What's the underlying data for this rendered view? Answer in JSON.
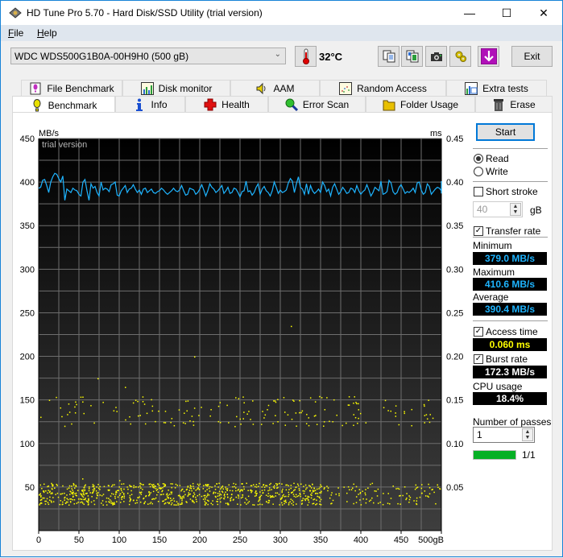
{
  "window": {
    "title": "HD Tune Pro 5.70 - Hard Disk/SSD Utility (trial version)",
    "controls": {
      "minimize": "—",
      "maximize": "☐",
      "close": "✕"
    }
  },
  "menu": [
    {
      "label": "File",
      "accel": "F",
      "rest": "ile"
    },
    {
      "label": "Help",
      "accel": "H",
      "rest": "elp"
    }
  ],
  "toolbar": {
    "drive": "WDC WDS500G1B0A-00H9H0 (500 gB)",
    "temperature": "32°C",
    "buttons": [
      "copy-text",
      "copy-screenshot",
      "camera",
      "options",
      "save"
    ],
    "exit_label": "Exit"
  },
  "tabs": {
    "top_row": [
      {
        "label": "File Benchmark",
        "icon": "file-benchmark-icon"
      },
      {
        "label": "Disk monitor",
        "icon": "disk-monitor-icon"
      },
      {
        "label": "AAM",
        "icon": "speaker-icon"
      },
      {
        "label": "Random Access",
        "icon": "random-access-icon"
      },
      {
        "label": "Extra tests",
        "icon": "extra-tests-icon"
      }
    ],
    "bottom_row": [
      {
        "label": "Benchmark",
        "icon": "benchmark-icon",
        "active": true
      },
      {
        "label": "Info",
        "icon": "info-icon"
      },
      {
        "label": "Health",
        "icon": "health-icon"
      },
      {
        "label": "Error Scan",
        "icon": "error-scan-icon"
      },
      {
        "label": "Folder Usage",
        "icon": "folder-icon"
      },
      {
        "label": "Erase",
        "icon": "trash-icon"
      }
    ]
  },
  "controls": {
    "start_label": "Start",
    "read_label": "Read",
    "write_label": "Write",
    "mode_selected": "Read",
    "short_stroke_label": "Short stroke",
    "short_stroke_checked": false,
    "short_stroke_value": "40",
    "short_stroke_unit": "gB",
    "transfer_rate_label": "Transfer rate",
    "transfer_rate_checked": true,
    "minimum_label": "Minimum",
    "minimum_value": "379.0 MB/s",
    "maximum_label": "Maximum",
    "maximum_value": "410.6 MB/s",
    "average_label": "Average",
    "average_value": "390.4 MB/s",
    "access_time_label": "Access time",
    "access_time_checked": true,
    "access_time_value": "0.060 ms",
    "burst_rate_label": "Burst rate",
    "burst_rate_checked": true,
    "burst_rate_value": "172.3 MB/s",
    "cpu_usage_label": "CPU usage",
    "cpu_usage_value": "18.4%",
    "passes_label": "Number of passes",
    "passes_value": "1",
    "progress_fraction": 1.0,
    "progress_text": "1/1"
  },
  "colors": {
    "transfer_line": "#1eb4ff",
    "access_points": "#ffff00",
    "value_cyan": "#1eb4ff",
    "value_yellow": "#ffff00",
    "value_white": "#ffffff",
    "progress": "#06b025"
  },
  "chart_data": {
    "type": "line",
    "title": "",
    "watermark": "trial version",
    "xlabel": "gB",
    "ylabel_left": "MB/s",
    "ylabel_right": "ms",
    "xlim": [
      0,
      500
    ],
    "ylim_left": [
      0,
      450
    ],
    "ylim_right": [
      0,
      0.45
    ],
    "x_ticks": [
      "0",
      "50",
      "100",
      "150",
      "200",
      "250",
      "300",
      "350",
      "400",
      "450",
      "500gB"
    ],
    "y_ticks_left": [
      "50",
      "100",
      "150",
      "200",
      "250",
      "300",
      "350",
      "400",
      "450"
    ],
    "y_ticks_right": [
      "0.05",
      "0.10",
      "0.15",
      "0.20",
      "0.25",
      "0.30",
      "0.35",
      "0.40",
      "0.45"
    ],
    "grid": true,
    "series": [
      {
        "name": "Transfer rate (MB/s)",
        "axis": "left",
        "x_step": 2.5,
        "values": [
          393,
          394,
          402,
          403,
          396,
          388,
          400,
          406,
          410,
          409,
          404,
          400,
          407,
          379,
          392,
          390,
          388,
          393,
          391,
          390,
          386,
          384,
          400,
          403,
          390,
          379,
          398,
          393,
          395,
          388,
          384,
          400,
          391,
          393,
          392,
          389,
          397,
          398,
          400,
          385,
          384,
          390,
          393,
          396,
          388,
          392,
          393,
          397,
          392,
          388,
          391,
          386,
          392,
          393,
          388,
          390,
          392,
          388,
          387,
          389,
          390,
          393,
          391,
          388,
          386,
          388,
          390,
          393,
          390,
          389,
          391,
          396,
          390,
          385,
          386,
          393,
          392,
          391,
          386,
          388,
          392,
          397,
          391,
          384,
          390,
          398,
          394,
          392,
          388,
          390,
          393,
          396,
          387,
          390,
          394,
          387,
          388,
          393,
          392,
          388,
          383,
          389,
          390,
          401,
          389,
          390,
          385,
          388,
          394,
          398,
          386,
          392,
          395,
          390,
          388,
          384,
          390,
          400,
          394,
          387,
          391,
          388,
          389,
          391,
          399,
          404,
          401,
          388,
          398,
          406,
          394,
          392,
          386,
          398,
          386,
          396,
          390,
          387,
          389,
          392,
          388,
          400,
          396,
          389,
          392,
          384,
          394,
          398,
          392,
          386,
          389,
          394,
          391,
          387,
          388,
          393,
          392,
          388,
          396,
          390,
          386,
          389,
          391,
          397,
          391,
          384,
          388,
          394,
          392,
          390,
          401,
          386,
          387,
          389,
          402,
          399,
          389,
          386,
          388,
          394,
          397,
          392,
          387,
          389,
          388,
          390,
          393,
          388,
          399,
          400,
          391,
          386,
          388,
          398,
          395,
          386,
          389,
          392,
          394,
          393,
          390,
          387,
          388,
          394,
          401,
          397,
          389,
          390,
          395,
          393,
          388,
          397,
          393,
          387,
          389,
          400
        ]
      },
      {
        "name": "Access time (ms)",
        "axis": "right",
        "style": "scatter",
        "bands": [
          {
            "ms_range": [
              0.03,
              0.055
            ],
            "density": "high"
          },
          {
            "ms_range": [
              0.12,
              0.155
            ],
            "density": "low"
          }
        ],
        "outliers_ms": [
          0.235,
          0.2,
          0.175,
          0.165,
          0.06,
          0.058
        ]
      }
    ]
  }
}
